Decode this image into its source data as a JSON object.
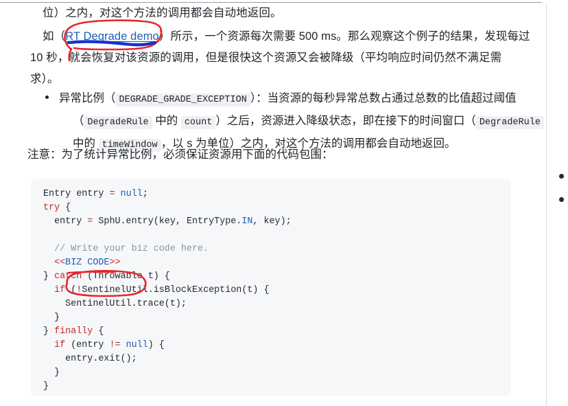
{
  "document": {
    "paragraph1": {
      "line1": "位）之内，对这个方法的调用都会自动地返回。",
      "line2_prefix": "如（",
      "line2_link": "RT Degrade demo",
      "line2_suffix": "）所示，一个资源每次需要 500 ms。那么观察这个例子的结果，发现每过",
      "line3": "10 秒，就会恢复对该资源的调用，但是很快这个资源又会被降级（平均响应时间仍然不满足需",
      "line4": "求）。"
    },
    "bullet": {
      "line1_a": "异常比例（",
      "line1_code": "DEGRADE_GRADE_EXCEPTION",
      "line1_b": "）：当资源的每秒异常总数占通过总数的比值超过阈值",
      "line2_a": "（",
      "line2_code1": "DegradeRule",
      "line2_b": "中的",
      "line2_code2": "count",
      "line2_c": "）之后，资源进入降级状态，即在接下的时间窗口（",
      "line2_code3": "DegradeRule",
      "line3_a": "中的",
      "line3_code": "timeWindow",
      "line3_b": "，以 s 为单位）之内，对这个方法的调用都会自动地返回。"
    },
    "note": "注意：为了统计异常比例，必须保证资源用下面的代码包围：",
    "code": {
      "l01_t1": "Entry",
      "l01_t2": " entry ",
      "l01_op": "=",
      "l01_t3": " ",
      "l01_null": "null",
      "l01_t4": ";",
      "l02_k": "try",
      "l02_t": " {",
      "l03_t1": "  entry ",
      "l03_op": "=",
      "l03_t2": " SphU.entry(key, EntryType.",
      "l03_in": "IN",
      "l03_t3": ", key);",
      "l04_blank": "",
      "l05_cm": "  // Write your biz code here.",
      "l06_a1": "  <<",
      "l06_biz": "BIZ CODE",
      "l06_a2": ">>",
      "l07_t1": "} ",
      "l07_k": "catch",
      "l07_t2": " (Throwable t) {",
      "l08_t1": "  ",
      "l08_k": "if",
      "l08_t2": " (",
      "l08_op": "!",
      "l08_t3": "SentinelUtil.isBlockException(t) {",
      "l09_t": "    SentinelUtil.trace(t);",
      "l10_t": "  }",
      "l11_t1": "} ",
      "l11_k": "finally",
      "l11_t2": " {",
      "l12_t1": "  ",
      "l12_k": "if",
      "l12_t2": " (entry ",
      "l12_op": "!=",
      "l12_t3": " ",
      "l12_null": "null",
      "l12_t4": ") {",
      "l13_t": "    entry.exit();",
      "l14_t": "  }",
      "l15_t": "}"
    }
  },
  "annotations": {
    "link_circle_color": "#e8252a",
    "link_underline_color": "#1633cf",
    "code_strike_color": "#e8252a",
    "code_circle_color": "#e8252a"
  },
  "gutter": {
    "dot_color": "#24292e",
    "dot_count": 2
  },
  "theme": {
    "page_background": "#ffffff",
    "text_color": "#1f2328",
    "link_color": "#1a5fb4",
    "code_background": "#f6f7f9",
    "inline_code_background": "#eef0f3",
    "keyword_color": "#c9252d",
    "literal_color": "#1a5fb4",
    "comment_color": "#8b949e"
  }
}
